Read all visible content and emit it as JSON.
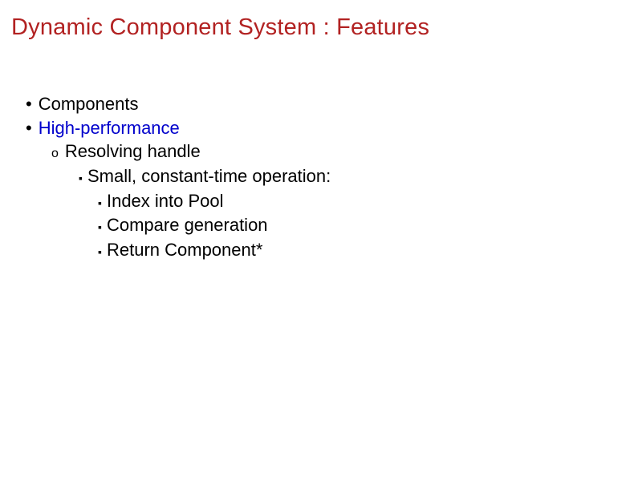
{
  "title": "Dynamic Component System : Features",
  "bullets": {
    "b0": "Components",
    "b1": "High-performance",
    "b1_0": "Resolving handle",
    "b1_0_0": "Small, constant-time operation:",
    "b1_0_0_0": "Index into Pool",
    "b1_0_0_1": "Compare generation",
    "b1_0_0_2": "Return Component*"
  },
  "glyphs": {
    "dot": "•",
    "circ": "o",
    "sq": "▪"
  }
}
